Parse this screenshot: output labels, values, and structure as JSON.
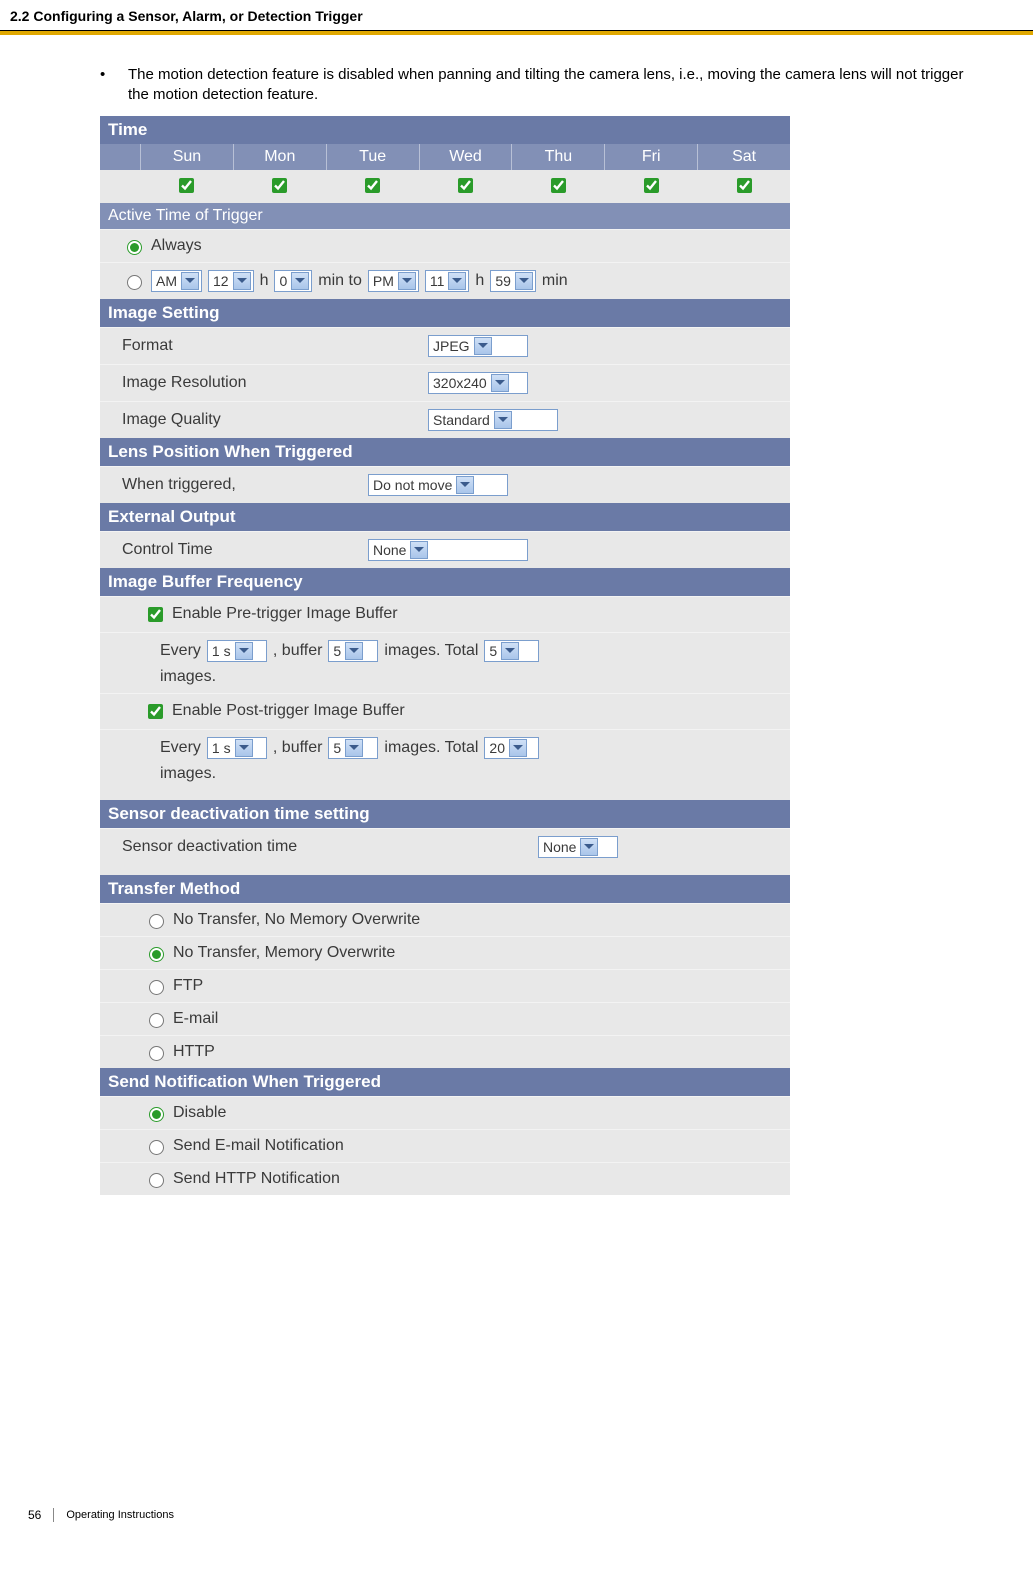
{
  "header": {
    "section_title": "2.2 Configuring a Sensor, Alarm, or Detection Trigger"
  },
  "bullet": {
    "text": "The motion detection feature is disabled when panning and tilting the camera lens, i.e., moving the camera lens will not trigger the motion detection feature."
  },
  "time": {
    "title": "Time",
    "days": [
      "Sun",
      "Mon",
      "Tue",
      "Wed",
      "Thu",
      "Fri",
      "Sat"
    ],
    "active_label": "Active Time of Trigger",
    "always": "Always",
    "ampm1": "AM",
    "h1": "12",
    "m1": "0",
    "to": "min to",
    "ampm2": "PM",
    "h2": "11",
    "m2": "59",
    "hlabel": "h",
    "minlabel": "min"
  },
  "image_setting": {
    "title": "Image Setting",
    "format_label": "Format",
    "format_value": "JPEG",
    "res_label": "Image Resolution",
    "res_value": "320x240",
    "quality_label": "Image Quality",
    "quality_value": "Standard"
  },
  "lens": {
    "title": "Lens Position When Triggered",
    "label": "When triggered,",
    "value": "Do not move"
  },
  "external": {
    "title": "External Output",
    "label": "Control Time",
    "value": "None"
  },
  "buffer": {
    "title": "Image Buffer Frequency",
    "pre_label": "Enable Pre-trigger Image Buffer",
    "post_label": "Enable Post-trigger Image Buffer",
    "every": "Every",
    "interval": "1 s",
    "buffer_word": ", buffer",
    "buffer_n": "5",
    "images_word": "images. Total",
    "pre_total": "5",
    "post_total": "20",
    "images_end": "images."
  },
  "deact": {
    "title": "Sensor deactivation time setting",
    "label": "Sensor deactivation time",
    "value": "None"
  },
  "transfer": {
    "title": "Transfer Method",
    "opt1": "No Transfer, No Memory Overwrite",
    "opt2": "No Transfer, Memory Overwrite",
    "opt3": "FTP",
    "opt4": "E-mail",
    "opt5": "HTTP"
  },
  "notify": {
    "title": "Send Notification When Triggered",
    "opt1": "Disable",
    "opt2": "Send E-mail Notification",
    "opt3": "Send HTTP Notification"
  },
  "footer": {
    "page": "56",
    "doc": "Operating Instructions"
  }
}
